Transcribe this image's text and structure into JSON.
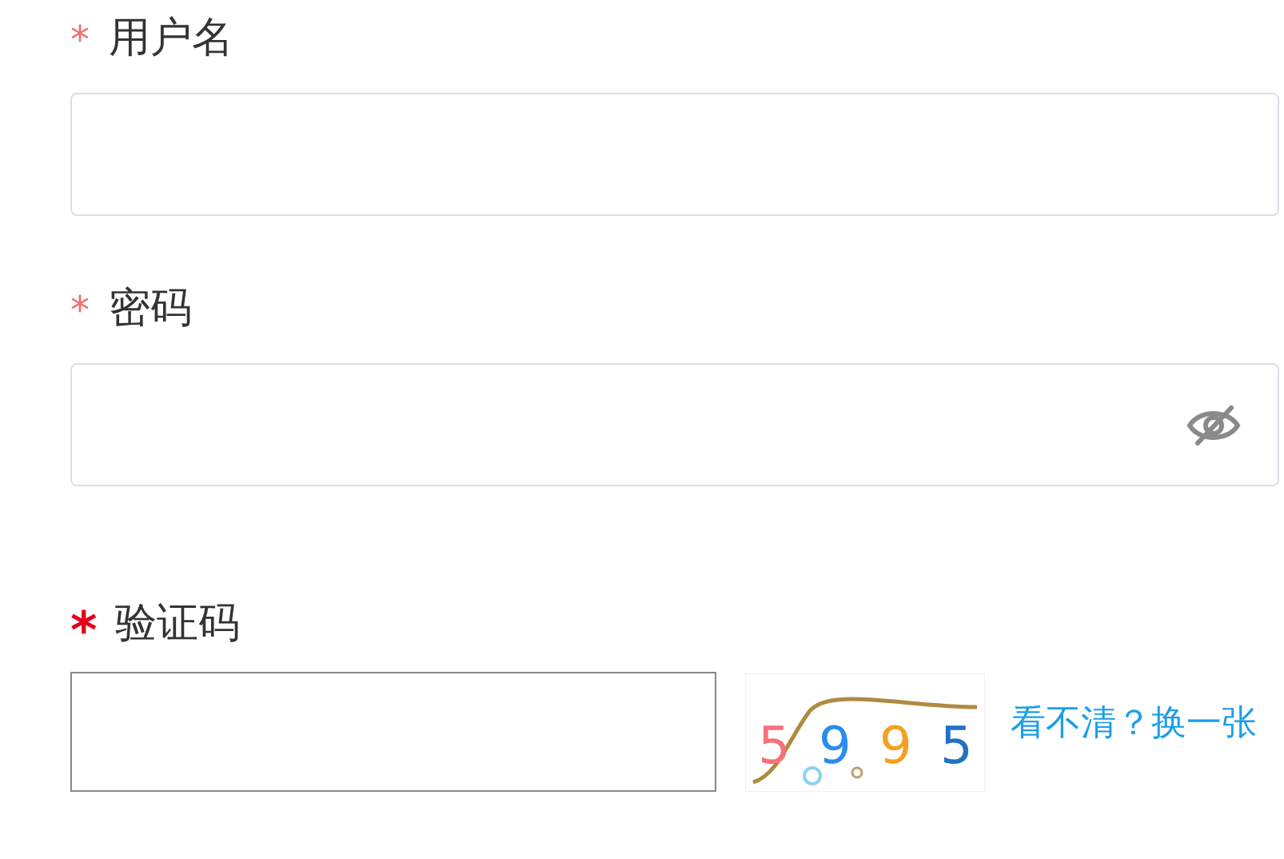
{
  "fields": [
    {
      "kind": "text",
      "mark": "*",
      "label": "用户名"
    },
    {
      "kind": "password",
      "mark": "*",
      "label": "密码"
    }
  ],
  "captcha": {
    "mark": "*",
    "label": "验证码",
    "chars": [
      {
        "text": "5",
        "color": "#f7707a"
      },
      {
        "text": "9",
        "color": "#2a8cf0"
      },
      {
        "text": "9",
        "color": "#f5a020"
      },
      {
        "text": "5",
        "color": "#2270c8"
      }
    ],
    "refresh_link": "看不清？换一张"
  }
}
